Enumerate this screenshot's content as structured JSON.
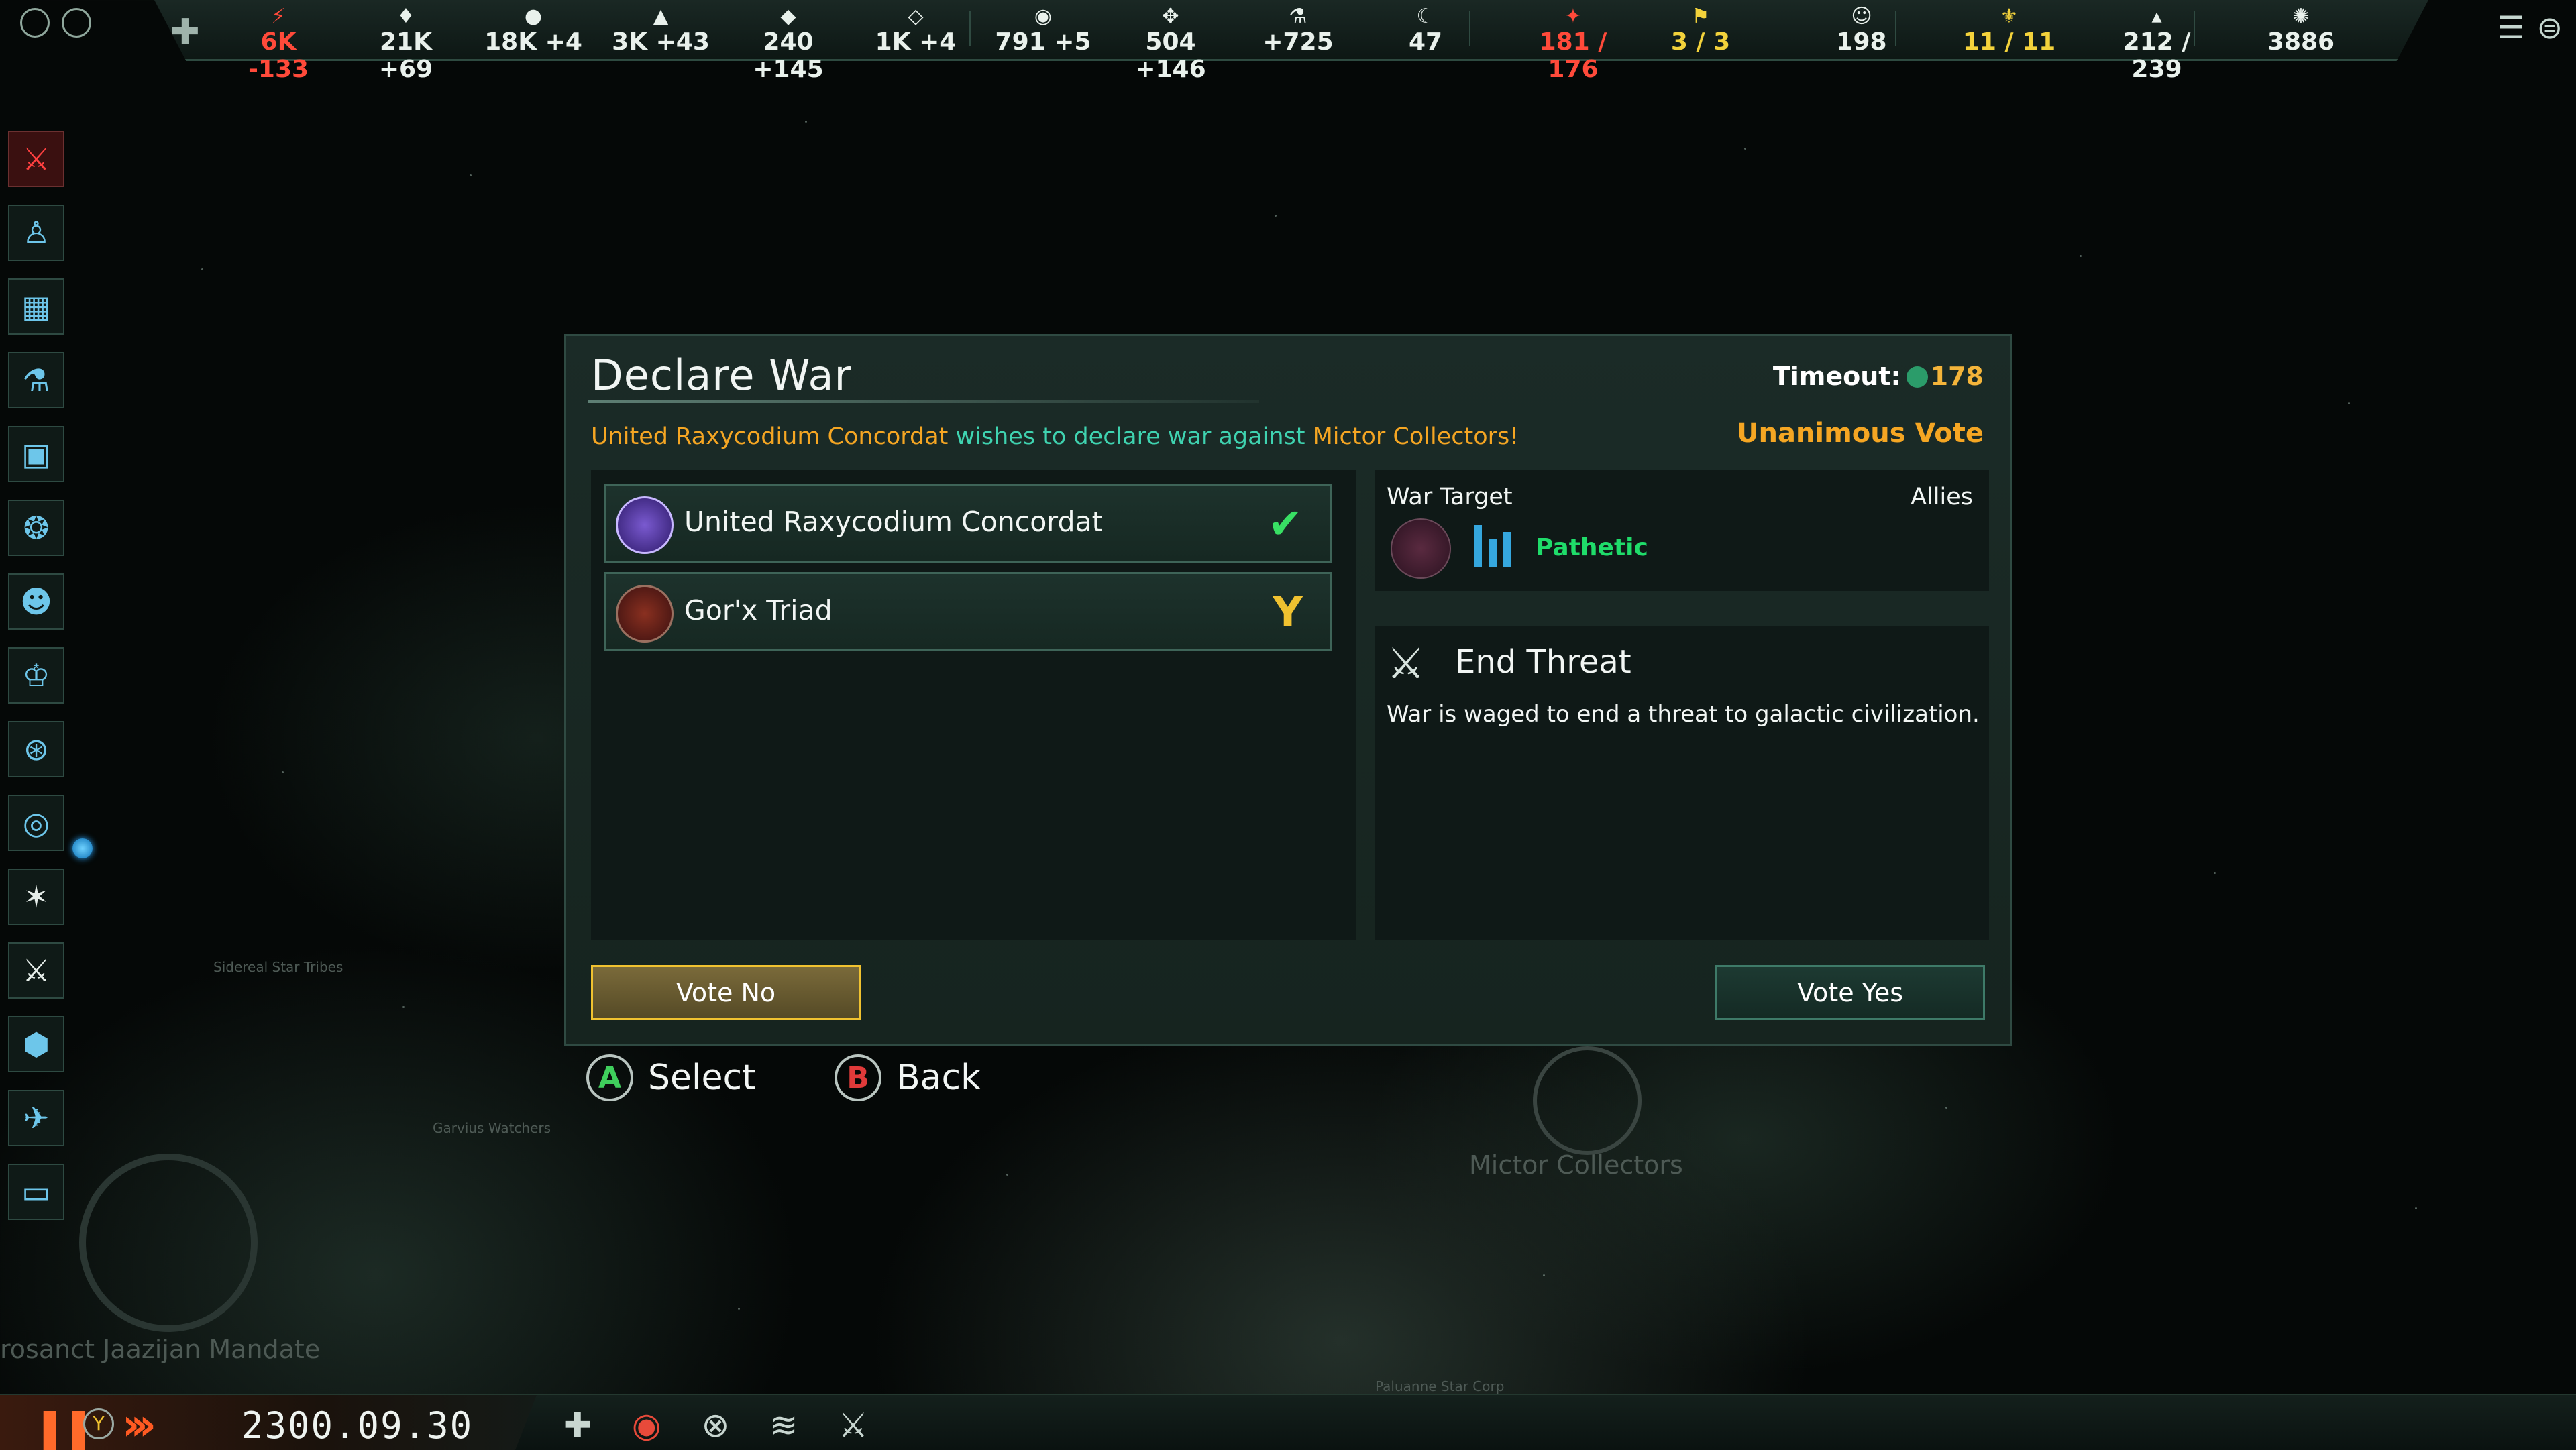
{
  "topbar": {
    "resources": [
      {
        "icon": "energy-icon",
        "glyph": "⚡",
        "value": "6K -133",
        "color": "#ff4a3a"
      },
      {
        "icon": "minerals-icon",
        "glyph": "♦",
        "value": "21K +69",
        "color": "#e9f1ec"
      },
      {
        "icon": "food-icon",
        "glyph": "●",
        "value": "18K +4",
        "color": "#e9f1ec"
      },
      {
        "icon": "consumer-goods-icon",
        "glyph": "▲",
        "value": "3K +43",
        "color": "#e9f1ec"
      },
      {
        "icon": "alloys-icon",
        "glyph": "◆",
        "value": "240 +145",
        "color": "#e9f1ec"
      },
      {
        "icon": "trade-icon",
        "glyph": "◇",
        "value": "1K +4",
        "color": "#e9f1ec"
      },
      {
        "icon": "influence-icon",
        "glyph": "◉",
        "value": "791 +5",
        "color": "#e9f1ec"
      },
      {
        "icon": "unity-icon",
        "glyph": "✥",
        "value": "504 +146",
        "color": "#e9f1ec"
      },
      {
        "icon": "research-icon",
        "glyph": "⚗",
        "value": "+725",
        "color": "#e9f1ec"
      },
      {
        "icon": "favors-icon",
        "glyph": "☾",
        "value": "47",
        "color": "#e9f1ec"
      },
      {
        "icon": "fleet-capacity-icon",
        "glyph": "✦",
        "value": "181 / 176",
        "color": "#ff4a3a"
      },
      {
        "icon": "starbase-capacity-icon",
        "glyph": "⚑",
        "value": "3 / 3",
        "color": "#f3d23b"
      },
      {
        "icon": "pops-icon",
        "glyph": "☺",
        "value": "198",
        "color": "#e9f1ec"
      },
      {
        "icon": "envoys-icon",
        "glyph": "⚜",
        "value": "11 / 11",
        "color": "#f3d23b"
      },
      {
        "icon": "naval-capacity-icon",
        "glyph": "▴",
        "value": "212 / 239",
        "color": "#e9f1ec"
      },
      {
        "icon": "stability-icon",
        "glyph": "✺",
        "value": "3886",
        "color": "#e9f1ec"
      }
    ]
  },
  "dialog": {
    "title": "Declare War",
    "timeout_label": "Timeout:",
    "timeout_value": "178",
    "subtitle_aggressor": "United Raxycodium Concordat",
    "subtitle_middle": " wishes to declare war against ",
    "subtitle_target": "Mictor Collectors",
    "subtitle_end": "!",
    "vote_type": "Unanimous Vote",
    "empires": [
      {
        "name": "United Raxycodium Concordat",
        "status": "yes",
        "mark": "✔",
        "mark_color": "#38e064"
      },
      {
        "name": "Gor'x Triad",
        "status": "pending",
        "mark": "Y",
        "mark_color": "#f0c230"
      }
    ],
    "war_target_label": "War Target",
    "allies_label": "Allies",
    "target_strength": "Pathetic",
    "war_goal_title": "End Threat",
    "war_goal_desc": "War is waged to end a threat to galactic civilization.",
    "vote_no": "Vote No",
    "vote_yes": "Vote Yes"
  },
  "hints": {
    "select_button": "A",
    "select_label": "Select",
    "back_button": "B",
    "back_label": "Back"
  },
  "map_labels": {
    "mictor": "Mictor Collectors",
    "garvius": "Garvius Watchers",
    "jaazijan": "rosanct Jaazijan Mandate",
    "sidereal": "Sidereal Star Tribes",
    "paluanne": "Paluanne Star Corp"
  },
  "bottombar": {
    "pause_icon": "pause-icon",
    "speed_button": "Y",
    "date": "2300.09.30"
  }
}
